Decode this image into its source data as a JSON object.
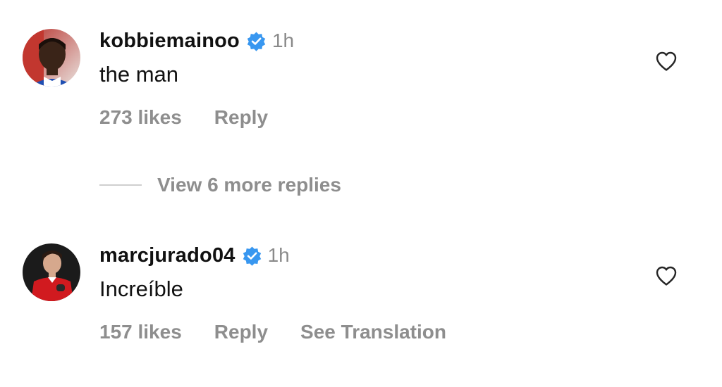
{
  "comments": [
    {
      "username": "kobbiemainoo",
      "verified": true,
      "time": "1h",
      "text": "the man",
      "likes": "273 likes",
      "reply_label": "Reply",
      "avatar_icon": "avatar-kobbiemainoo"
    },
    {
      "username": "marcjurado04",
      "verified": true,
      "time": "1h",
      "text": "Increíble",
      "likes": "157 likes",
      "reply_label": "Reply",
      "translate_label": "See Translation",
      "avatar_icon": "avatar-marcjurado04"
    }
  ],
  "view_more_replies": "View 6 more replies",
  "colors": {
    "verified_blue": "#3897f0",
    "secondary_text": "#8e8e8e",
    "primary_text": "#111111"
  }
}
